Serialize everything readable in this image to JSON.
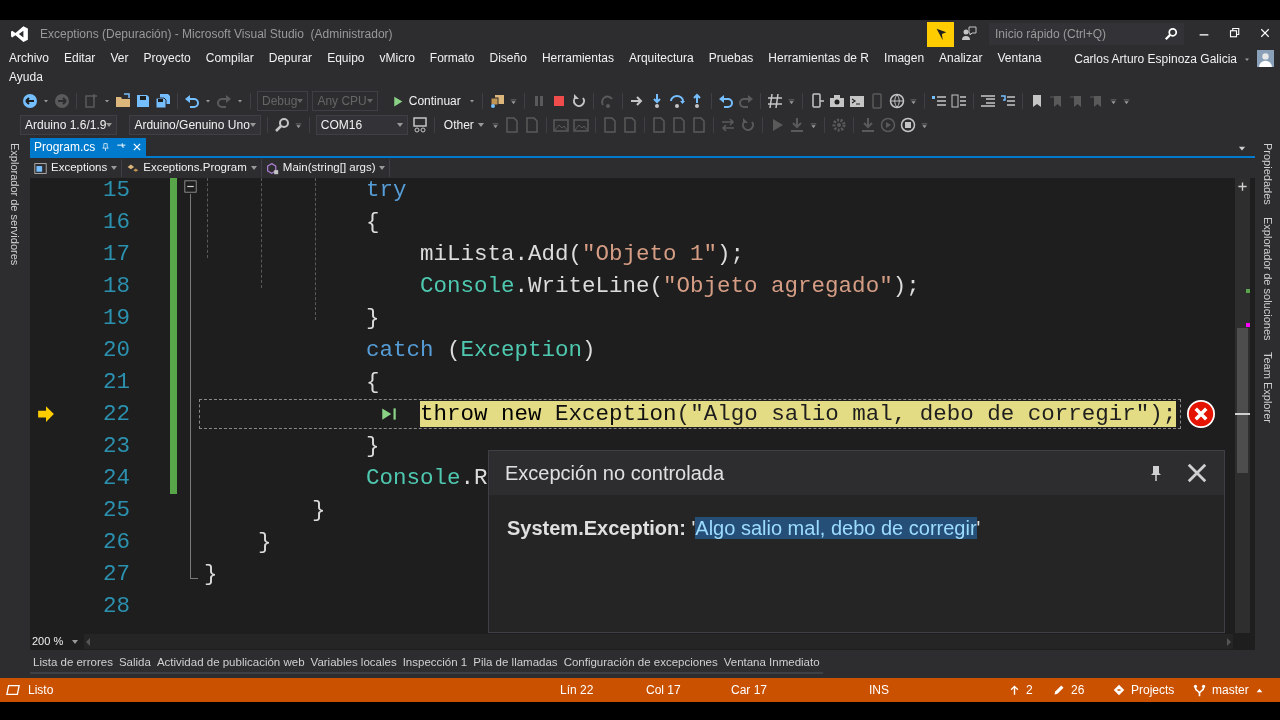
{
  "window": {
    "title": "Exceptions (Depuración) - Microsoft Visual Studio  (Administrador)"
  },
  "quick_launch": {
    "placeholder": "Inicio rápido (Ctrl+Q)"
  },
  "menu": [
    "Archivo",
    "Editar",
    "Ver",
    "Proyecto",
    "Compilar",
    "Depurar",
    "Equipo",
    "vMicro",
    "Formato",
    "Diseño",
    "Herramientas",
    "Arquitectura",
    "Pruebas",
    "Herramientas de R",
    "Imagen",
    "Analizar",
    "Ventana",
    "Ayuda"
  ],
  "user": {
    "name": "Carlos Arturo Espinoza Galicia"
  },
  "debug_toolbar": {
    "configuration": {
      "text": "Debug",
      "disabled": true
    },
    "platform": {
      "text": "Any CPU",
      "disabled": true
    },
    "continue_button": "Continuar"
  },
  "arduino_toolbar": {
    "ide_version": "Arduino 1.6/1.9",
    "board": "Arduino/Genuino Uno",
    "port": "COM16",
    "other_button": "Other"
  },
  "left_panel_tabs": [
    "Explorador de servidores"
  ],
  "right_panel_tabs": [
    "Propiedades",
    "Explorador de soluciones",
    "Team Explorer"
  ],
  "document_tabs": [
    {
      "label": "Program.cs",
      "selected": true
    }
  ],
  "navigation": {
    "project": "Exceptions",
    "type": "Exceptions.Program",
    "member": "Main(string[] args)"
  },
  "code": {
    "lines": [
      {
        "number": "15",
        "changed": true,
        "current": false,
        "tokens": [
          {
            "text": "            try",
            "kind": "keyword"
          }
        ]
      },
      {
        "number": "16",
        "changed": true,
        "current": false,
        "tokens": [
          {
            "text": "            {",
            "kind": "plain"
          }
        ]
      },
      {
        "number": "17",
        "changed": true,
        "current": false,
        "tokens": [
          {
            "text": "                miLista.Add(",
            "kind": "plain"
          },
          {
            "text": "\"Objeto 1\"",
            "kind": "string"
          },
          {
            "text": ");",
            "kind": "plain"
          }
        ]
      },
      {
        "number": "18",
        "changed": true,
        "current": false,
        "tokens": [
          {
            "text": "                Console",
            "kind": "type"
          },
          {
            "text": ".WriteLine(",
            "kind": "plain"
          },
          {
            "text": "\"Objeto agregado\"",
            "kind": "string"
          },
          {
            "text": ");",
            "kind": "plain"
          }
        ]
      },
      {
        "number": "19",
        "changed": true,
        "current": false,
        "tokens": [
          {
            "text": "            }",
            "kind": "plain"
          }
        ]
      },
      {
        "number": "20",
        "changed": true,
        "current": false,
        "tokens": [
          {
            "text": "            catch",
            "kind": "keyword"
          },
          {
            "text": " (",
            "kind": "plain"
          },
          {
            "text": "Exception",
            "kind": "type"
          },
          {
            "text": ")",
            "kind": "plain"
          }
        ]
      },
      {
        "number": "21",
        "changed": true,
        "current": false,
        "tokens": [
          {
            "text": "            {",
            "kind": "plain"
          }
        ]
      },
      {
        "number": "22",
        "changed": true,
        "current": true,
        "tokens": [
          {
            "text": "                throw new",
            "kind": "keyword"
          },
          {
            "text": " Exception",
            "kind": "type"
          },
          {
            "text": "(",
            "kind": "plain"
          },
          {
            "text": "\"Algo salio mal, debo de corregir\"",
            "kind": "string"
          },
          {
            "text": ");",
            "kind": "plain"
          }
        ]
      },
      {
        "number": "23",
        "changed": true,
        "current": false,
        "tokens": [
          {
            "text": "            }",
            "kind": "plain"
          }
        ]
      },
      {
        "number": "24",
        "changed": true,
        "current": false,
        "tokens": [
          {
            "text": "            Console",
            "kind": "type"
          },
          {
            "text": ".R",
            "kind": "plain"
          }
        ]
      },
      {
        "number": "25",
        "changed": false,
        "current": false,
        "tokens": [
          {
            "text": "        }",
            "kind": "plain"
          }
        ]
      },
      {
        "number": "26",
        "changed": false,
        "current": false,
        "tokens": [
          {
            "text": "    }",
            "kind": "plain"
          }
        ]
      },
      {
        "number": "27",
        "changed": false,
        "current": false,
        "tokens": [
          {
            "text": "}",
            "kind": "plain"
          }
        ]
      },
      {
        "number": "28",
        "changed": false,
        "current": false
      }
    ]
  },
  "exception_popup": {
    "title": "Excepción no controlada",
    "type": "System.Exception:",
    "quote_open": "'",
    "message": "Algo salio mal, debo de corregir",
    "message_selected": true,
    "quote_close": "'"
  },
  "zoom": "200 %",
  "tool_window_tabs": [
    "Lista de errores",
    "Salida",
    "Actividad de publicación web",
    "Variables locales",
    "Inspección 1",
    "Pila de llamadas",
    "Configuración de excepciones",
    "Ventana Inmediato"
  ],
  "status_bar": {
    "state": "Listo",
    "line": "Lín 22",
    "column": "Col 17",
    "character": "Car 17",
    "mode": "INS",
    "pushes": "2",
    "changes": "26",
    "projects": "Projects",
    "branch": "master"
  }
}
